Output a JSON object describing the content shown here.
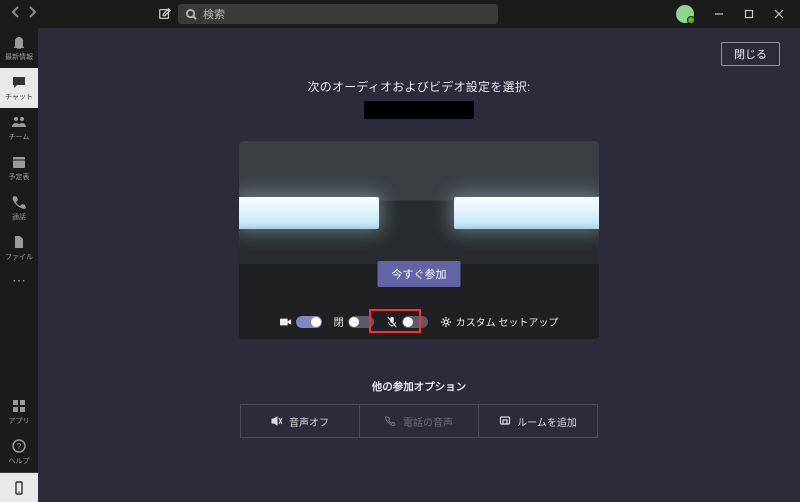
{
  "titlebar": {
    "search_placeholder": "検索"
  },
  "rail": {
    "items": [
      {
        "label": "最新情報"
      },
      {
        "label": "チャット"
      },
      {
        "label": "チーム"
      },
      {
        "label": "予定表"
      },
      {
        "label": "通話"
      },
      {
        "label": "ファイル"
      }
    ],
    "bottom": [
      {
        "label": "アプリ"
      },
      {
        "label": "ヘルプ"
      }
    ]
  },
  "meeting": {
    "close_label": "閉じる",
    "heading": "次のオーディオおよびビデオ設定を選択:",
    "join_label": "今すぐ参加",
    "controls": {
      "video_label_hidden": "",
      "bg_label": "閉",
      "setup_label": "カスタム セットアップ"
    },
    "other_heading": "他の参加オプション",
    "options": {
      "audio_off": "音声オフ",
      "phone_audio": "電話の音声",
      "add_room": "ルームを追加"
    }
  }
}
